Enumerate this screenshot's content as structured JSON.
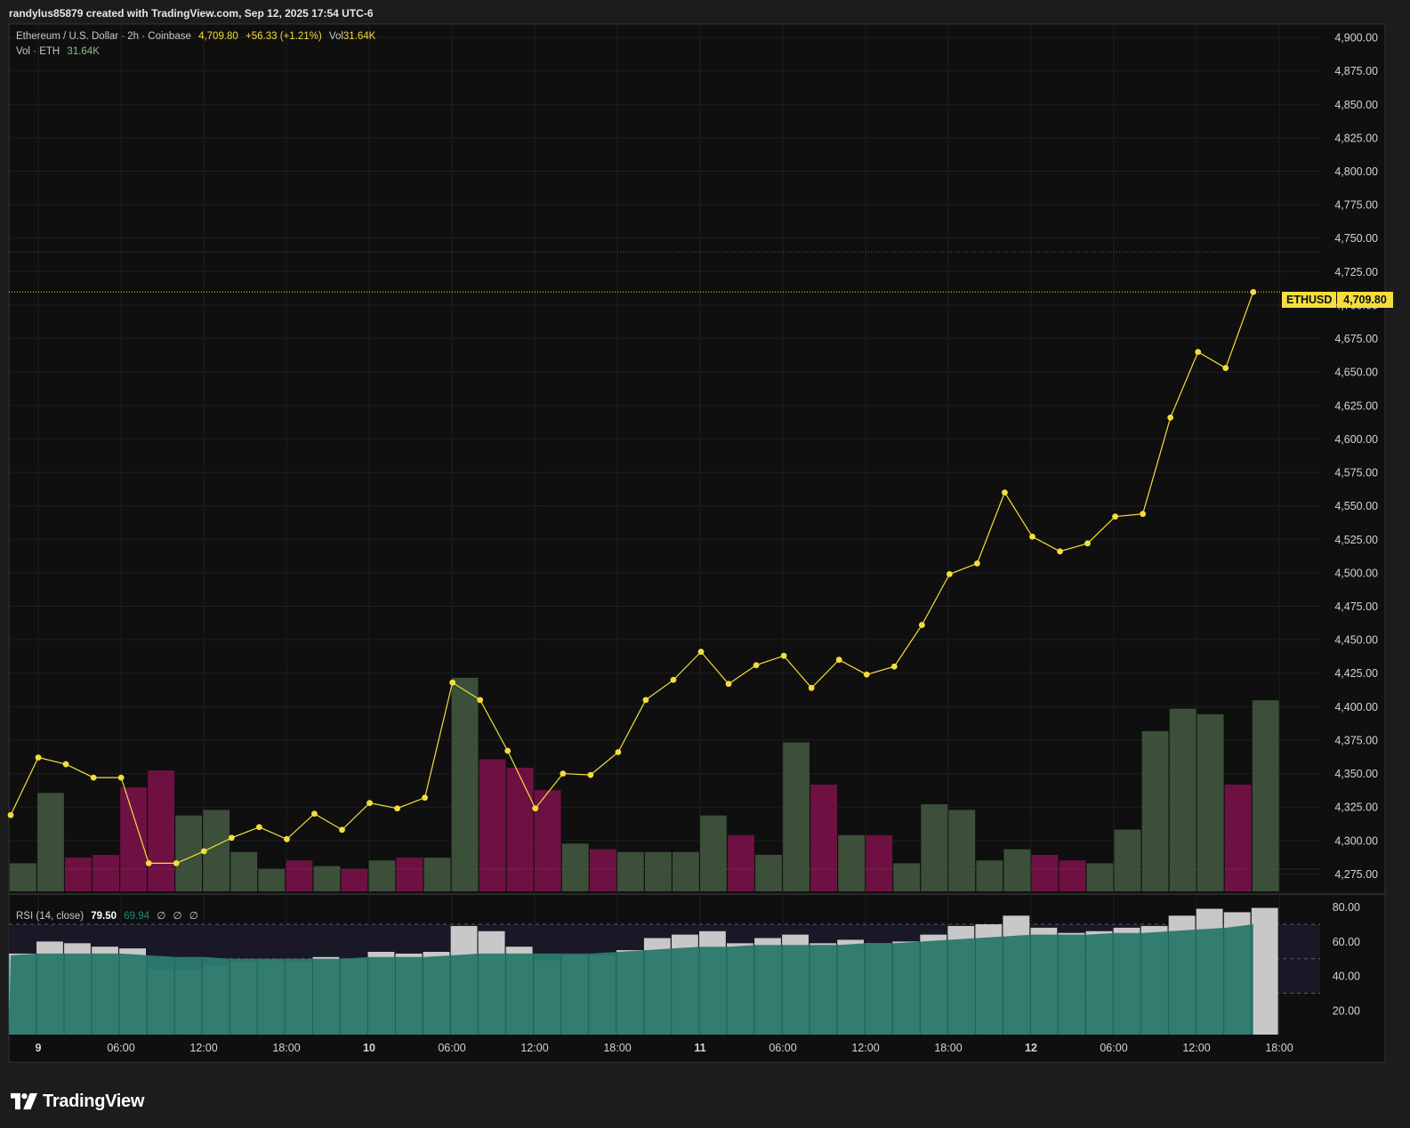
{
  "header": {
    "attribution": "randylus85879 created with TradingView.com, Sep 12, 2025 17:54 UTC-6"
  },
  "legend": {
    "symbol": "Ethereum / U.S. Dollar · 2h · Coinbase",
    "last": "4,709.80",
    "change": "+56.33 (+1.21%)",
    "vol_label": "Vol",
    "vol_value": "31.64K",
    "vol2_label": "Vol · ETH",
    "vol2_value": "31.64K"
  },
  "rsi_legend": {
    "label": "RSI (14, close)",
    "value": "79.50",
    "ma": "69.94",
    "empty1": "∅",
    "empty2": "∅",
    "empty3": "∅"
  },
  "price_tag": {
    "symbol": "ETHUSD",
    "value": "4,709.80"
  },
  "brand": {
    "name": "TradingView"
  },
  "colors": {
    "background": "#0f0f0f",
    "grid": "#1f1f1f",
    "line": "#f5dd3b",
    "vol_up": "#3b4f39",
    "vol_down": "#6e1142",
    "rsi_fill": "#2c7a6c",
    "rsi_bar": "#c8c8c8"
  },
  "chart_data": [
    {
      "type": "line",
      "title": "Ethereum / U.S. Dollar · 2h · Coinbase",
      "series": [
        {
          "name": "ETHUSD",
          "values": [
            4319,
            4362,
            4357,
            4347,
            4347,
            4283,
            4283,
            4292,
            4302,
            4310,
            4301,
            4320,
            4308,
            4328,
            4324,
            4332,
            4418,
            4405,
            4367,
            4324,
            4350,
            4349,
            4366,
            4405,
            4420,
            4441,
            4417,
            4431,
            4438,
            4414,
            4435,
            4424,
            4430,
            4461,
            4499,
            4507,
            4560,
            4527,
            4516,
            4522,
            4542,
            4544,
            4616,
            4665,
            4653,
            4709.8
          ]
        }
      ],
      "ylim": [
        4262,
        4910
      ],
      "yticks": [
        "4,275.00",
        "4,300.00",
        "4,325.00",
        "4,350.00",
        "4,375.00",
        "4,400.00",
        "4,425.00",
        "4,450.00",
        "4,475.00",
        "4,500.00",
        "4,525.00",
        "4,550.00",
        "4,575.00",
        "4,600.00",
        "4,625.00",
        "4,650.00",
        "4,675.00",
        "4,700.00",
        "4,725.00",
        "4,750.00",
        "4,775.00",
        "4,800.00",
        "4,825.00",
        "4,850.00",
        "4,875.00",
        "4,900.00"
      ],
      "xticks": [
        "9",
        "06:00",
        "12:00",
        "18:00",
        "10",
        "06:00",
        "12:00",
        "18:00",
        "11",
        "06:00",
        "12:00",
        "18:00",
        "12",
        "06:00",
        "12:00",
        "18:00"
      ]
    },
    {
      "type": "bar",
      "title": "Vol · ETH",
      "values": [
        0.1,
        0.35,
        0.12,
        0.13,
        0.37,
        0.43,
        0.27,
        0.29,
        0.14,
        0.08,
        0.11,
        0.09,
        0.08,
        0.11,
        0.12,
        0.12,
        0.76,
        0.47,
        0.44,
        0.36,
        0.17,
        0.15,
        0.14,
        0.14,
        0.14,
        0.27,
        0.2,
        0.13,
        0.53,
        0.38,
        0.2,
        0.2,
        0.1,
        0.31,
        0.29,
        0.11,
        0.15,
        0.13,
        0.11,
        0.1,
        0.22,
        0.57,
        0.65,
        0.63,
        0.38,
        0.68
      ],
      "directions": [
        "up",
        "up",
        "down",
        "down",
        "down",
        "down",
        "up",
        "up",
        "up",
        "up",
        "down",
        "up",
        "down",
        "up",
        "down",
        "up",
        "up",
        "down",
        "down",
        "down",
        "up",
        "down",
        "up",
        "up",
        "up",
        "up",
        "down",
        "up",
        "up",
        "down",
        "up",
        "down",
        "up",
        "up",
        "up",
        "up",
        "up",
        "down",
        "down",
        "up",
        "up",
        "up",
        "up",
        "up",
        "down",
        "up"
      ]
    },
    {
      "type": "area",
      "title": "RSI (14, close)",
      "values": [
        52,
        53,
        53,
        53,
        53,
        52,
        51,
        51,
        50,
        50,
        50,
        50,
        50,
        51,
        51,
        51,
        52,
        53,
        53,
        53,
        53,
        53,
        54,
        55,
        56,
        57,
        57,
        58,
        58,
        58,
        58,
        59,
        59,
        60,
        61,
        62,
        63,
        64,
        64,
        64,
        65,
        65,
        66,
        67,
        68,
        70
      ],
      "bars": [
        53,
        60,
        59,
        57,
        56,
        44,
        44,
        46,
        48,
        49,
        48,
        51,
        50,
        54,
        53,
        54,
        69,
        66,
        57,
        49,
        52,
        52,
        55,
        62,
        64,
        66,
        59,
        62,
        64,
        59,
        61,
        59,
        60,
        64,
        69,
        70,
        75,
        68,
        65,
        66,
        68,
        69,
        75,
        79,
        77,
        79.5
      ],
      "ylim": [
        6,
        86
      ],
      "yticks": [
        "20.00",
        "40.00",
        "60.00",
        "80.00"
      ],
      "bands": [
        30,
        50,
        70
      ]
    }
  ]
}
